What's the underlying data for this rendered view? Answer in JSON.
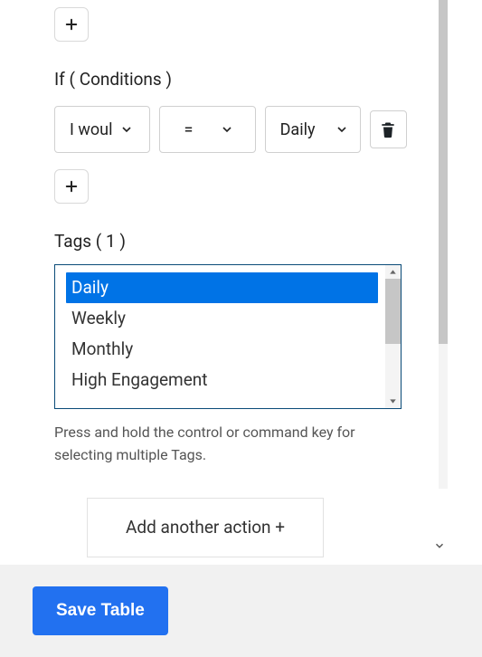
{
  "conditions": {
    "label": "If ( Conditions )",
    "row": {
      "field_display": "I woul",
      "operator_display": "=",
      "value_display": "Daily"
    }
  },
  "tags": {
    "label": "Tags ( 1 )",
    "options": [
      "Daily",
      "Weekly",
      "Monthly",
      "High Engagement"
    ],
    "selected_index": 0,
    "hint": "Press and hold the control or command key for selecting multiple Tags."
  },
  "buttons": {
    "add_action": "Add another action +",
    "save": "Save Table"
  }
}
